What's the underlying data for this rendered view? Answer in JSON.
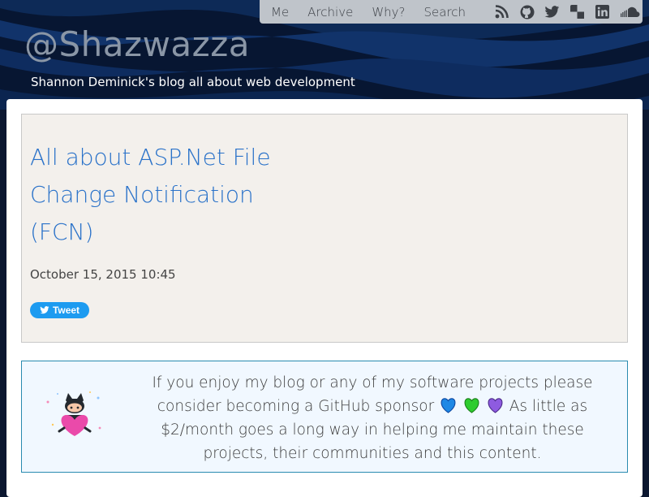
{
  "nav": {
    "links": [
      "Me",
      "Archive",
      "Why?",
      "Search"
    ],
    "icons": [
      "rss-icon",
      "github-icon",
      "twitter-icon",
      "delicious-icon",
      "linkedin-icon",
      "soundcloud-icon"
    ]
  },
  "site": {
    "title": "@Shazwazza",
    "tagline": "Shannon Deminick's blog all about web development"
  },
  "post": {
    "title": "All about ASP.Net File Change Notification (FCN)",
    "date": "October 15, 2015 10:45",
    "tweet_label": "Tweet"
  },
  "sponsor": {
    "text_before": "If you enjoy my blog or any of my software projects please consider becoming a GitHub sponsor",
    "text_after": "As little as $2/month goes a long way in helping me maintain these projects, their communities and this content.",
    "hearts": [
      "#1e88e5",
      "#2ecc2e",
      "#8e5be0"
    ]
  },
  "colors": {
    "accent": "#2a72c9",
    "hero": "#091a36",
    "tweet": "#1d9bf0"
  }
}
